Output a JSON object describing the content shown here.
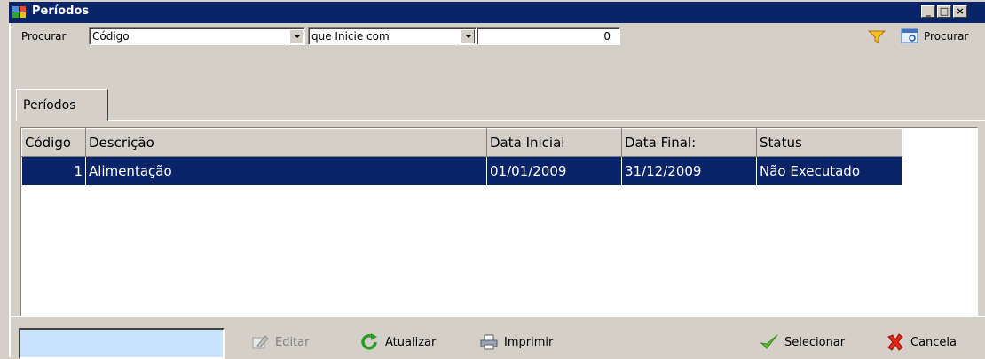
{
  "window": {
    "title": "Períodos",
    "min_label": "_",
    "max_label": "□",
    "close_label": "×"
  },
  "search": {
    "label": "Procurar",
    "field_value": "Código",
    "operator_value": "que Inicie com",
    "value": "0",
    "search_button_label": "Procurar"
  },
  "tabs": [
    {
      "label": "Períodos"
    }
  ],
  "grid": {
    "columns": [
      "Código",
      "Descrição",
      "Data Inicial",
      "Data Final:",
      "Status"
    ],
    "rows": [
      [
        "1",
        "Alimentação",
        "01/01/2009",
        "31/12/2009",
        "Não Executado"
      ]
    ]
  },
  "bottom": {
    "edit_label": "Editar",
    "refresh_label": "Atualizar",
    "print_label": "Imprimir",
    "select_label": "Selecionar",
    "cancel_label": "Cancela"
  },
  "colors": {
    "titlebar": "#0a246a",
    "selection": "#0a246a",
    "window_bg": "#d4d0c8",
    "input_bg": "#c8e4ff"
  }
}
